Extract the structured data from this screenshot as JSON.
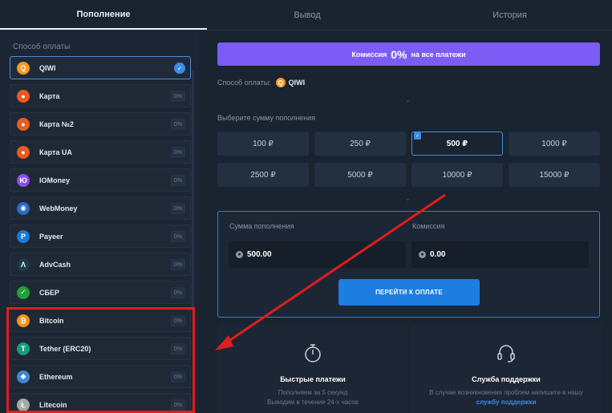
{
  "tabs": [
    "Пополнение",
    "Вывод",
    "История"
  ],
  "sidebar": {
    "title": "Способ оплаты",
    "methods": [
      {
        "label": "QIWI",
        "fee": "",
        "icon": "qiwi-icon",
        "color": "#f59a23",
        "glyph": "Q",
        "selected": true
      },
      {
        "label": "Карта",
        "fee": "0%",
        "icon": "mastercard-icon",
        "color": "#eb5a1e",
        "glyph": "●"
      },
      {
        "label": "Карта №2",
        "fee": "0%",
        "icon": "mastercard-icon",
        "color": "#eb5a1e",
        "glyph": "●"
      },
      {
        "label": "Карта UA",
        "fee": "0%",
        "icon": "mastercard-icon",
        "color": "#eb5a1e",
        "glyph": "●"
      },
      {
        "label": "IOMoney",
        "fee": "0%",
        "icon": "iomoney-icon",
        "color": "#8a4df0",
        "glyph": "Ю"
      },
      {
        "label": "WebMoney",
        "fee": "0%",
        "icon": "webmoney-icon",
        "color": "#2a6bc2",
        "glyph": "◉"
      },
      {
        "label": "Payeer",
        "fee": "0%",
        "icon": "payeer-icon",
        "color": "#1b79d6",
        "glyph": "P"
      },
      {
        "label": "AdvCash",
        "fee": "0%",
        "icon": "advcash-icon",
        "color": "#1d3a4a",
        "glyph": "Λ"
      },
      {
        "label": "СБЕР",
        "fee": "0%",
        "icon": "sber-icon",
        "color": "#21a038",
        "glyph": "✓"
      },
      {
        "label": "Bitcoin",
        "fee": "0%",
        "icon": "bitcoin-icon",
        "color": "#f7931a",
        "glyph": "₿"
      },
      {
        "label": "Tether (ERC20)",
        "fee": "0%",
        "icon": "tether-icon",
        "color": "#1a9b7c",
        "glyph": "T"
      },
      {
        "label": "Ethereum",
        "fee": "0%",
        "icon": "ethereum-icon",
        "color": "#3c8ad6",
        "glyph": "◆"
      },
      {
        "label": "Litecoin",
        "fee": "0%",
        "icon": "litecoin-icon",
        "color": "#a6a9aa",
        "glyph": "Ł"
      }
    ]
  },
  "banner": {
    "prefix": "Комиссия",
    "pct": "0%",
    "suffix": "на все платежи"
  },
  "pay_method": {
    "label": "Способ оплаты:",
    "value": "QIWI"
  },
  "amount_section": {
    "label": "Выберите сумму пополнения",
    "options": [
      "100 ₽",
      "250 ₽",
      "500 ₽",
      "1000 ₽",
      "2500 ₽",
      "5000 ₽",
      "10000 ₽",
      "15000 ₽"
    ],
    "selected": "500 ₽"
  },
  "payment_box": {
    "amount_label": "Сумма пополнения",
    "amount_value": "500.00",
    "fee_label": "Комиссия",
    "fee_value": "0.00",
    "button": "ПЕРЕЙТИ К ОПЛАТЕ"
  },
  "features": {
    "fast": {
      "title": "Быстрые платежи",
      "line1": "Пополняем за 5 секунд",
      "line2": "Выводим в течение 24-х часов"
    },
    "support": {
      "title": "Служба поддержки",
      "line1": "В случае возникновения проблем напишите в нашу",
      "link": "службу поддержки"
    }
  },
  "colors": {
    "accent": "#7b5cf5",
    "primary_button": "#1d7de0",
    "highlight": "#e01d1d"
  }
}
